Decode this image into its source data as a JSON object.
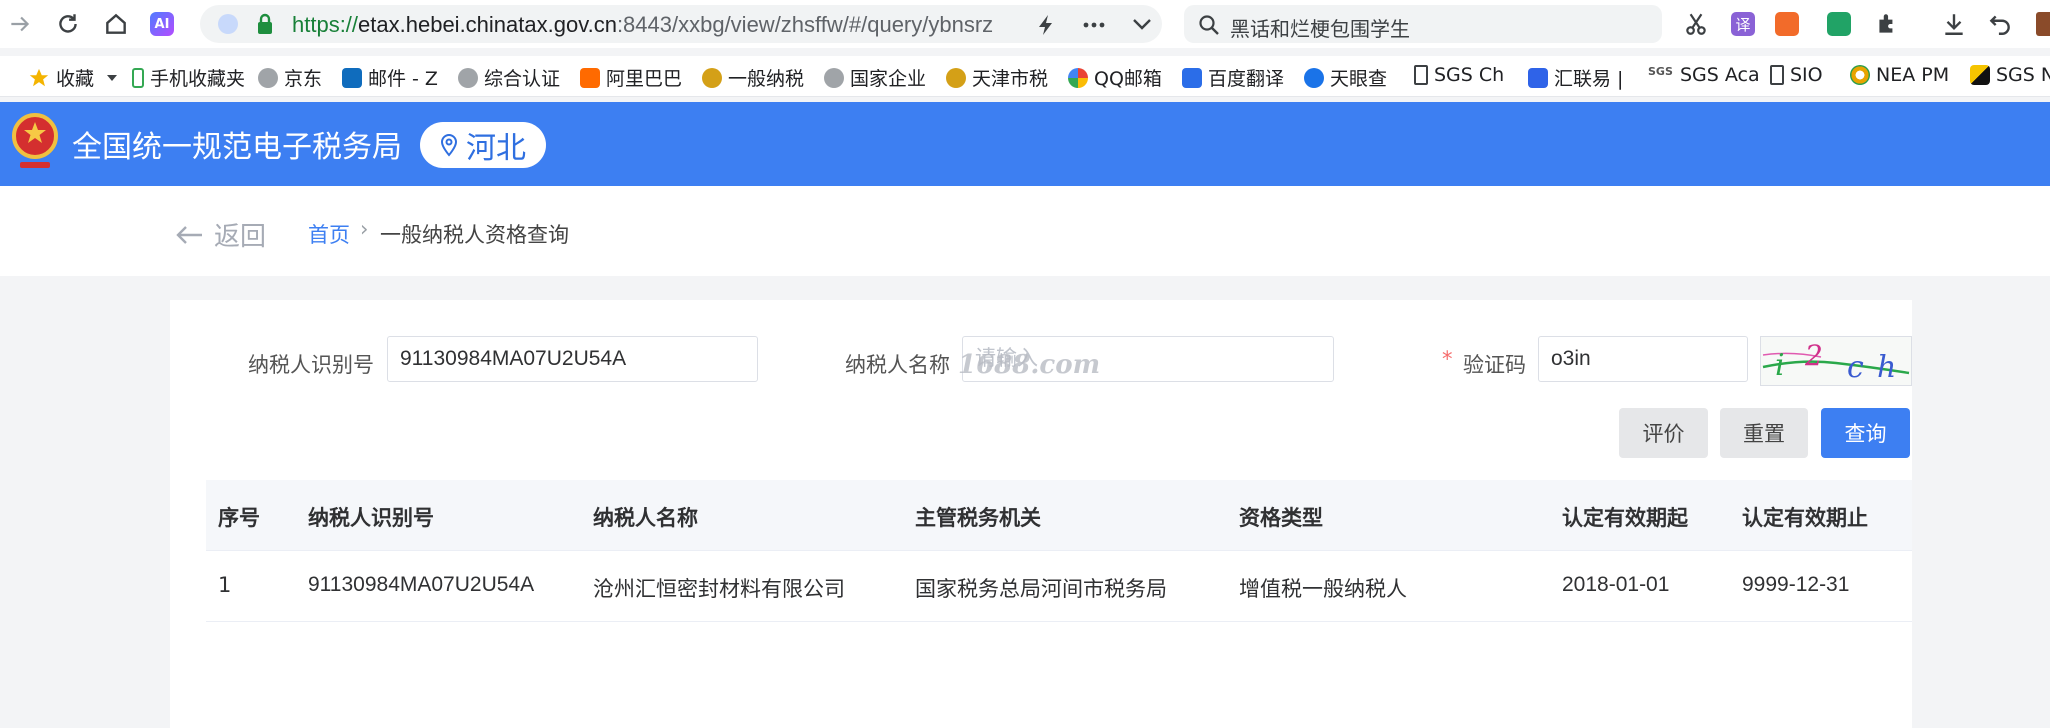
{
  "browser": {
    "url_scheme": "https://",
    "url_host": "etax.hebei.chinatax.gov.cn",
    "url_rest": ":8443/xxbg/view/zhsffw/#/query/ybnsrz",
    "search_text": "黑话和烂梗包围学生",
    "ai_label": "AI"
  },
  "bookmarks": [
    {
      "label": "收藏",
      "icon": "star-icon"
    },
    {
      "label": "手机收藏夹",
      "icon": "phone-icon"
    },
    {
      "label": "京东",
      "icon": "globe-icon"
    },
    {
      "label": "邮件 - Z",
      "icon": "outlook-icon"
    },
    {
      "label": "综合认证",
      "icon": "globe-icon"
    },
    {
      "label": "阿里巴巴",
      "icon": "alibaba-icon"
    },
    {
      "label": "一般纳税",
      "icon": "emblem-icon"
    },
    {
      "label": "国家企业",
      "icon": "globe-icon"
    },
    {
      "label": "天津市税",
      "icon": "emblem-icon"
    },
    {
      "label": "QQ邮箱",
      "icon": "qqmail-icon"
    },
    {
      "label": "百度翻译",
      "icon": "translate-icon"
    },
    {
      "label": "天眼查",
      "icon": "tianyancha-icon"
    },
    {
      "label": "SGS Ch",
      "icon": "page-icon"
    },
    {
      "label": "汇联易 |",
      "icon": "huilianyi-icon"
    },
    {
      "label": "SGS Aca",
      "icon": "sgs-icon"
    },
    {
      "label": "SIO",
      "icon": "page-icon"
    },
    {
      "label": "NEA PM",
      "icon": "nea-icon"
    },
    {
      "label": "SGS N",
      "icon": "sgs-flag-icon"
    }
  ],
  "header": {
    "title": "全国统一规范电子税务局",
    "region": "河北"
  },
  "breadcrumb": {
    "back_label": "返回",
    "home": "首页",
    "separator": "›",
    "current": "一般纳税人资格查询"
  },
  "form": {
    "taxpayer_id_label": "纳税人识别号",
    "taxpayer_id_value": "91130984MA07U2U54A",
    "taxpayer_name_label": "纳税人名称",
    "taxpayer_name_placeholder": "请输入",
    "watermark": "1688.com",
    "captcha_required_mark": "*",
    "captcha_label": "验证码",
    "captcha_value": "o3in",
    "captcha_image_text": "i2ch"
  },
  "buttons": {
    "evaluate": "评价",
    "reset": "重置",
    "query": "查询"
  },
  "table": {
    "columns": [
      "序号",
      "纳税人识别号",
      "纳税人名称",
      "主管税务机关",
      "资格类型",
      "认定有效期起",
      "认定有效期止"
    ],
    "rows": [
      [
        "1",
        "91130984MA07U2U54A",
        "沧州汇恒密封材料有限公司",
        "国家税务总局河间市税务局",
        "增值税一般纳税人",
        "2018-01-01",
        "9999-12-31"
      ]
    ]
  },
  "colors": {
    "brand_blue": "#3d7ff2",
    "required_red": "#f56c6c"
  }
}
